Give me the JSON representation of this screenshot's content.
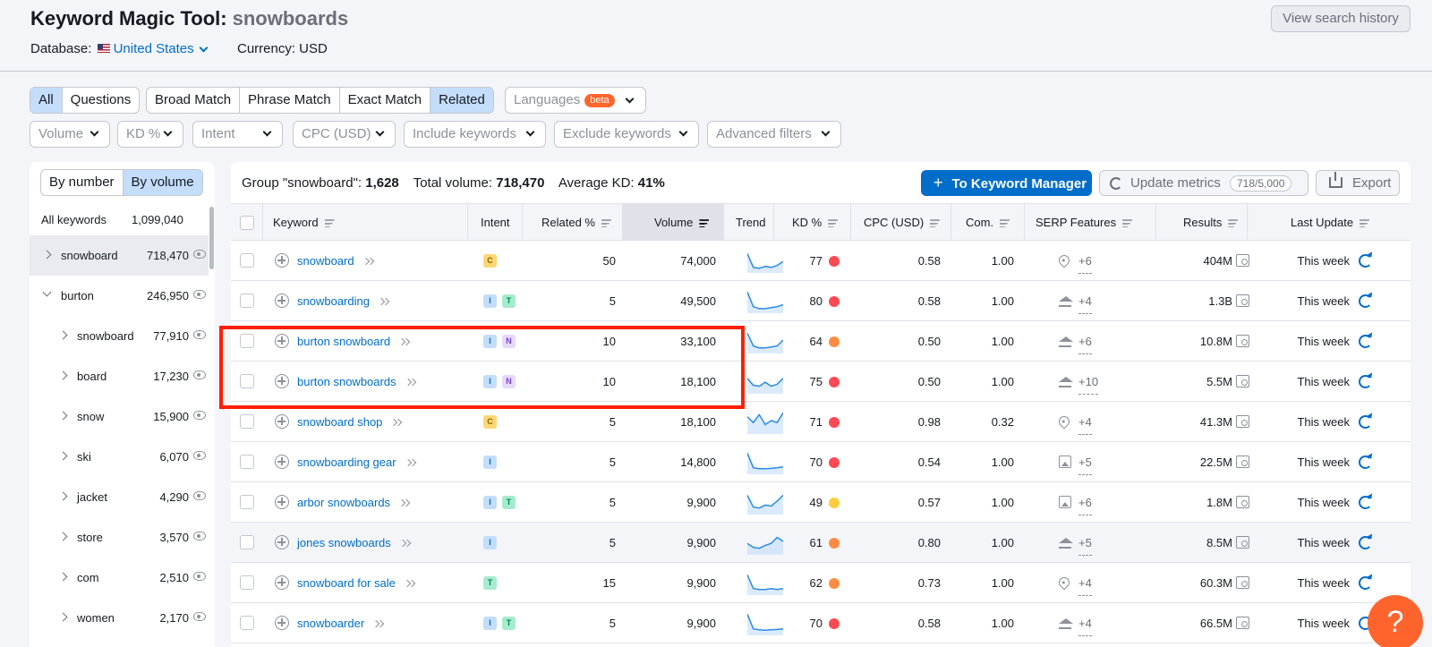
{
  "header": {
    "title": "Keyword Magic Tool:",
    "query": "snowboards",
    "database_label": "Database:",
    "database_value": "United States",
    "currency": "Currency: USD",
    "view_history": "View search history"
  },
  "tabs_match": {
    "group1": [
      "All",
      "Questions"
    ],
    "group2": [
      "Broad Match",
      "Phrase Match",
      "Exact Match",
      "Related"
    ],
    "active": [
      "All",
      "Related"
    ]
  },
  "languages": {
    "label": "Languages",
    "badge": "beta"
  },
  "filters": [
    "Volume",
    "KD %",
    "Intent",
    "CPC (USD)",
    "Include keywords",
    "Exclude keywords",
    "Advanced filters"
  ],
  "left_panel": {
    "toggle": [
      "By number",
      "By volume"
    ],
    "all_label": "All keywords",
    "all_count": "1,099,040",
    "groups": [
      {
        "name": "snowboard",
        "count": "718,470",
        "level": 0,
        "selected": true
      },
      {
        "name": "burton",
        "count": "246,950",
        "level": 0,
        "expanded": true
      },
      {
        "name": "snowboard",
        "count": "77,910",
        "level": 1
      },
      {
        "name": "board",
        "count": "17,230",
        "level": 1
      },
      {
        "name": "snow",
        "count": "15,900",
        "level": 1
      },
      {
        "name": "ski",
        "count": "6,070",
        "level": 1
      },
      {
        "name": "jacket",
        "count": "4,290",
        "level": 1
      },
      {
        "name": "store",
        "count": "3,570",
        "level": 1
      },
      {
        "name": "com",
        "count": "2,510",
        "level": 1
      },
      {
        "name": "women",
        "count": "2,170",
        "level": 1
      }
    ]
  },
  "summary": {
    "group_label": "Group \"snowboard\":",
    "group_value": "1,628",
    "total_label": "Total volume:",
    "total_value": "718,470",
    "kd_label": "Average KD:",
    "kd_value": "41%"
  },
  "actions": {
    "to_manager": "To Keyword Manager",
    "update": "Update metrics",
    "update_count": "718/5,000",
    "export": "Export"
  },
  "columns": [
    "Keyword",
    "Intent",
    "Related %",
    "Volume",
    "Trend",
    "KD %",
    "CPC (USD)",
    "Com.",
    "SERP Features",
    "Results",
    "Last Update"
  ],
  "rows": [
    {
      "keyword": "snowboard",
      "intent": [
        "C"
      ],
      "related": "50",
      "volume": "74,000",
      "kd": "77",
      "kd_color": "#ff4953",
      "cpc": "0.58",
      "com": "1.00",
      "serp_icon": "pin",
      "serp": "+6",
      "results": "404M",
      "update": "This week",
      "trend": [
        0.2,
        0.9,
        0.95,
        0.85,
        0.9,
        0.8,
        0.6
      ]
    },
    {
      "keyword": "snowboarding",
      "intent": [
        "I",
        "T"
      ],
      "related": "5",
      "volume": "49,500",
      "kd": "80",
      "kd_color": "#ff4953",
      "cpc": "0.58",
      "com": "1.00",
      "serp_icon": "cap",
      "serp": "+4",
      "results": "1.3B",
      "update": "This week",
      "trend": [
        0.1,
        0.85,
        0.95,
        0.95,
        0.9,
        0.85,
        0.75
      ]
    },
    {
      "keyword": "burton snowboard",
      "intent": [
        "I",
        "N"
      ],
      "related": "10",
      "volume": "33,100",
      "kd": "64",
      "kd_color": "#ff8c43",
      "cpc": "0.50",
      "com": "1.00",
      "serp_icon": "cap",
      "serp": "+6",
      "results": "10.8M",
      "update": "This week",
      "trend": [
        0.15,
        0.8,
        0.9,
        0.9,
        0.85,
        0.8,
        0.5
      ]
    },
    {
      "keyword": "burton snowboards",
      "intent": [
        "I",
        "N"
      ],
      "related": "10",
      "volume": "18,100",
      "kd": "75",
      "kd_color": "#ff4953",
      "cpc": "0.50",
      "com": "1.00",
      "serp_icon": "cap",
      "serp": "+10",
      "results": "5.5M",
      "update": "This week",
      "trend": [
        0.4,
        0.75,
        0.8,
        0.6,
        0.8,
        0.7,
        0.4
      ]
    },
    {
      "keyword": "snowboard shop",
      "intent": [
        "C"
      ],
      "related": "5",
      "volume": "18,100",
      "kd": "71",
      "kd_color": "#ff4953",
      "cpc": "0.98",
      "com": "0.32",
      "serp_icon": "pin",
      "serp": "+4",
      "results": "41.3M",
      "update": "This week",
      "trend": [
        0.3,
        0.6,
        0.2,
        0.7,
        0.5,
        0.6,
        0.1
      ]
    },
    {
      "keyword": "snowboarding gear",
      "intent": [
        "I"
      ],
      "related": "5",
      "volume": "14,800",
      "kd": "70",
      "kd_color": "#ff4953",
      "cpc": "0.54",
      "com": "1.00",
      "serp_icon": "img",
      "serp": "+5",
      "results": "22.5M",
      "update": "This week",
      "trend": [
        0.1,
        0.85,
        0.9,
        0.9,
        0.88,
        0.85,
        0.8
      ]
    },
    {
      "keyword": "arbor snowboards",
      "intent": [
        "I",
        "T"
      ],
      "related": "5",
      "volume": "9,900",
      "kd": "49",
      "kd_color": "#ffcc3d",
      "cpc": "0.57",
      "com": "1.00",
      "serp_icon": "img",
      "serp": "+6",
      "results": "1.8M",
      "update": "This week",
      "trend": [
        0.2,
        0.8,
        0.85,
        0.7,
        0.75,
        0.5,
        0.2
      ]
    },
    {
      "keyword": "jones snowboards",
      "intent": [
        "I"
      ],
      "related": "5",
      "volume": "9,900",
      "kd": "61",
      "kd_color": "#ff8c43",
      "cpc": "0.80",
      "com": "1.00",
      "serp_icon": "cap",
      "serp": "+5",
      "results": "8.5M",
      "update": "This week",
      "trend": [
        0.6,
        0.8,
        0.85,
        0.7,
        0.6,
        0.3,
        0.5
      ]
    },
    {
      "keyword": "snowboard for sale",
      "intent": [
        "T"
      ],
      "related": "15",
      "volume": "9,900",
      "kd": "62",
      "kd_color": "#ff8c43",
      "cpc": "0.73",
      "com": "1.00",
      "serp_icon": "pin",
      "serp": "+4",
      "results": "60.3M",
      "update": "This week",
      "trend": [
        0.15,
        0.85,
        0.9,
        0.9,
        0.85,
        0.9,
        0.85
      ]
    },
    {
      "keyword": "snowboarder",
      "intent": [
        "I",
        "T"
      ],
      "related": "5",
      "volume": "9,900",
      "kd": "70",
      "kd_color": "#ff4953",
      "cpc": "0.58",
      "com": "1.00",
      "serp_icon": "cap",
      "serp": "+4",
      "results": "66.5M",
      "update": "This week",
      "trend": [
        0.1,
        0.85,
        0.9,
        0.92,
        0.9,
        0.88,
        0.85
      ]
    }
  ],
  "help": "?",
  "colors": {
    "accent": "#006dca",
    "highlight": "#ff1f00",
    "help": "#ff642d"
  }
}
